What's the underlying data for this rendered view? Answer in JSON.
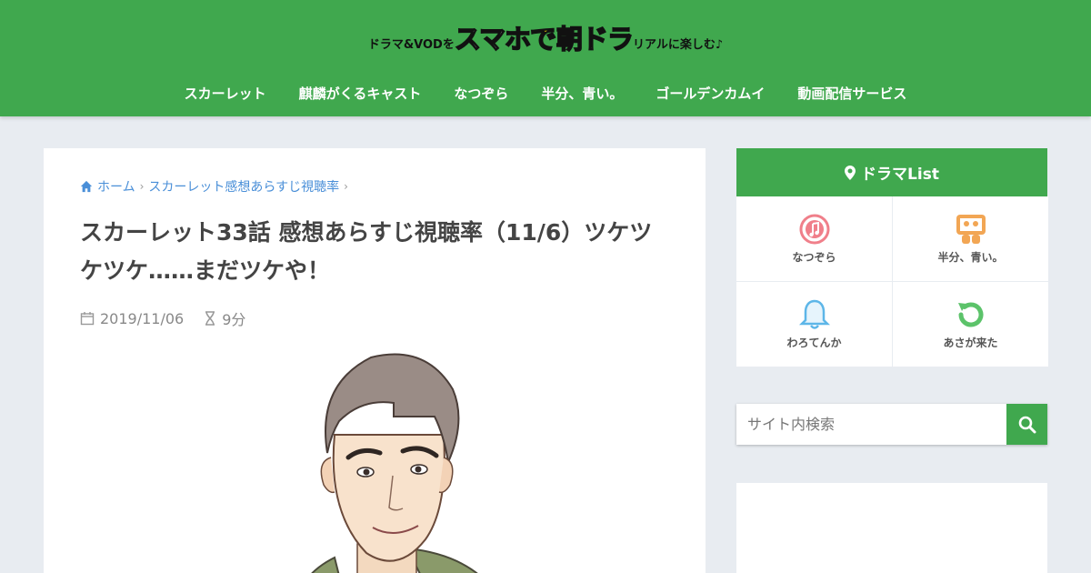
{
  "header": {
    "logo": {
      "prefix": "ドラマ&VODを",
      "big1": "スマホ",
      "de": "で",
      "big2": "朝ドラ",
      "suffix": "リアルに楽しむ♪"
    },
    "nav": [
      {
        "label": "スカーレット"
      },
      {
        "label": "麒麟がくるキャスト"
      },
      {
        "label": "なつぞら"
      },
      {
        "label": "半分、青い。"
      },
      {
        "label": "ゴールデンカムイ"
      },
      {
        "label": "動画配信サービス"
      }
    ]
  },
  "breadcrumb": {
    "home": "ホーム",
    "category": "スカーレット感想あらすじ視聴率"
  },
  "article": {
    "title": "スカーレット33話 感想あらすじ視聴率（11/6）ツケツケツケ……まだツケや！",
    "date": "2019/11/06",
    "read_time": "9分"
  },
  "sidebar": {
    "list_title": "ドラマList",
    "items": [
      {
        "label": "なつぞら",
        "icon": "music-icon",
        "color": "#f07f8a"
      },
      {
        "label": "半分、青い。",
        "icon": "group-icon",
        "color": "#f2a654"
      },
      {
        "label": "わろてんか",
        "icon": "bell-icon",
        "color": "#5db6e8"
      },
      {
        "label": "あさが来た",
        "icon": "refresh-icon",
        "color": "#5cc36a"
      }
    ],
    "search_placeholder": "サイト内検索"
  },
  "colors": {
    "brand_green": "#40a84e",
    "link_blue": "#4a8fd8"
  }
}
